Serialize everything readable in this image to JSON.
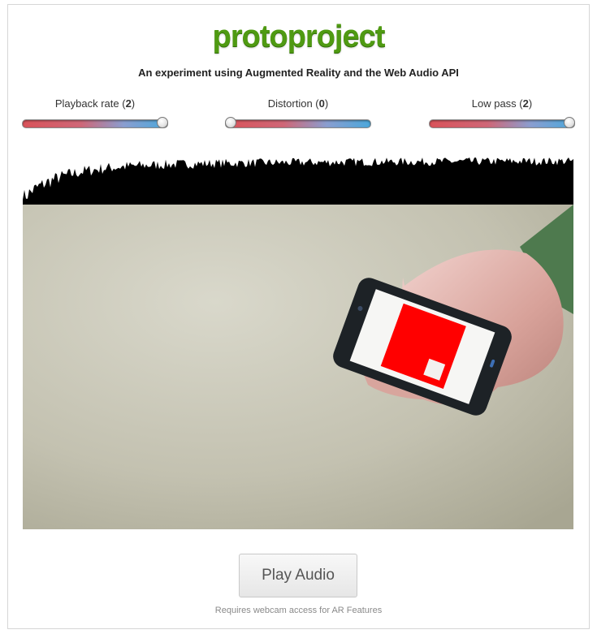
{
  "app": {
    "title": "protoproject",
    "subtitle": "An experiment using Augmented Reality and the Web Audio API"
  },
  "controls": [
    {
      "label": "Playback rate",
      "value": "2",
      "fraction": 1.0
    },
    {
      "label": "Distortion",
      "value": "0",
      "fraction": 0.0
    },
    {
      "label": "Low pass",
      "value": "2",
      "fraction": 1.0
    }
  ],
  "actions": {
    "play_label": "Play Audio"
  },
  "footer": {
    "note": "Requires webcam access for AR Features"
  },
  "colors": {
    "title": "#4f9a12",
    "marker_square": "#ff0000",
    "waveform": "#000000",
    "sleeve": "#4e7a4e"
  }
}
